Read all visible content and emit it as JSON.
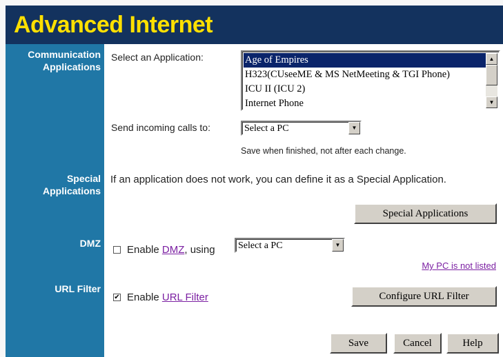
{
  "header": {
    "title": "Advanced Internet"
  },
  "sidebar": {
    "comm": [
      "Communication",
      "Applications"
    ],
    "special": [
      "Special",
      "Applications"
    ],
    "dmz": "DMZ",
    "url": "URL Filter"
  },
  "comm": {
    "select_app_label": "Select an Application:",
    "apps": [
      "Age of Empires",
      "H323(CUseeME & MS NetMeeting & TGI Phone)",
      "ICU II (ICU 2)",
      "Internet Phone"
    ],
    "send_calls_label": "Send incoming calls to:",
    "send_calls_value": "Select a PC",
    "save_note": "Save when finished, not after each change."
  },
  "special": {
    "text": "If an application does not work, you can define it as a Special Application.",
    "button": "Special Applications"
  },
  "dmz": {
    "enable_prefix": "Enable ",
    "link": "DMZ",
    "suffix": ", using",
    "select_value": "Select a PC",
    "not_listed": "My PC is not listed"
  },
  "url": {
    "enable_prefix": "Enable ",
    "link": "URL Filter",
    "configure_button": "Configure URL Filter"
  },
  "footer": {
    "save": "Save",
    "cancel": "Cancel",
    "help": "Help"
  }
}
